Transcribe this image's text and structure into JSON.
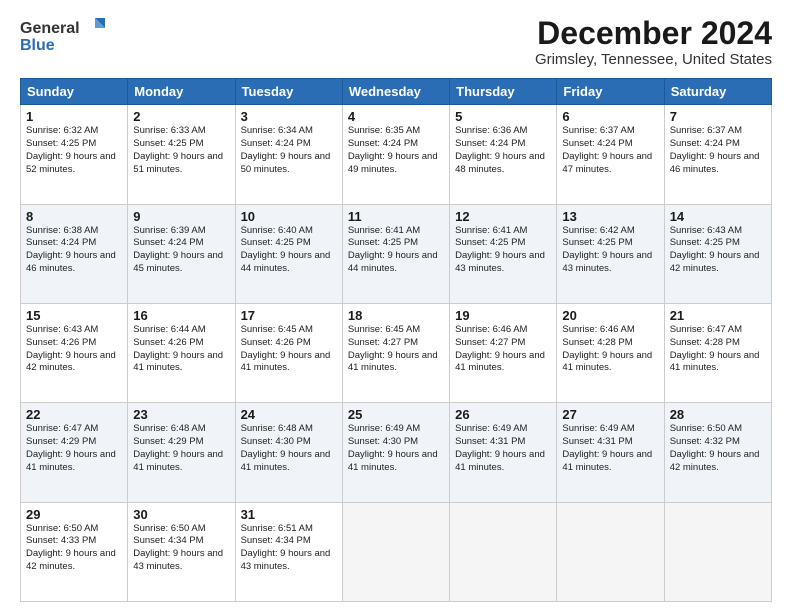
{
  "header": {
    "logo_general": "General",
    "logo_blue": "Blue",
    "title": "December 2024",
    "subtitle": "Grimsley, Tennessee, United States"
  },
  "days_of_week": [
    "Sunday",
    "Monday",
    "Tuesday",
    "Wednesday",
    "Thursday",
    "Friday",
    "Saturday"
  ],
  "weeks": [
    [
      {
        "day": "1",
        "sunrise": "6:32 AM",
        "sunset": "4:25 PM",
        "daylight": "9 hours and 52 minutes."
      },
      {
        "day": "2",
        "sunrise": "6:33 AM",
        "sunset": "4:25 PM",
        "daylight": "9 hours and 51 minutes."
      },
      {
        "day": "3",
        "sunrise": "6:34 AM",
        "sunset": "4:24 PM",
        "daylight": "9 hours and 50 minutes."
      },
      {
        "day": "4",
        "sunrise": "6:35 AM",
        "sunset": "4:24 PM",
        "daylight": "9 hours and 49 minutes."
      },
      {
        "day": "5",
        "sunrise": "6:36 AM",
        "sunset": "4:24 PM",
        "daylight": "9 hours and 48 minutes."
      },
      {
        "day": "6",
        "sunrise": "6:37 AM",
        "sunset": "4:24 PM",
        "daylight": "9 hours and 47 minutes."
      },
      {
        "day": "7",
        "sunrise": "6:37 AM",
        "sunset": "4:24 PM",
        "daylight": "9 hours and 46 minutes."
      }
    ],
    [
      {
        "day": "8",
        "sunrise": "6:38 AM",
        "sunset": "4:24 PM",
        "daylight": "9 hours and 46 minutes."
      },
      {
        "day": "9",
        "sunrise": "6:39 AM",
        "sunset": "4:24 PM",
        "daylight": "9 hours and 45 minutes."
      },
      {
        "day": "10",
        "sunrise": "6:40 AM",
        "sunset": "4:25 PM",
        "daylight": "9 hours and 44 minutes."
      },
      {
        "day": "11",
        "sunrise": "6:41 AM",
        "sunset": "4:25 PM",
        "daylight": "9 hours and 44 minutes."
      },
      {
        "day": "12",
        "sunrise": "6:41 AM",
        "sunset": "4:25 PM",
        "daylight": "9 hours and 43 minutes."
      },
      {
        "day": "13",
        "sunrise": "6:42 AM",
        "sunset": "4:25 PM",
        "daylight": "9 hours and 43 minutes."
      },
      {
        "day": "14",
        "sunrise": "6:43 AM",
        "sunset": "4:25 PM",
        "daylight": "9 hours and 42 minutes."
      }
    ],
    [
      {
        "day": "15",
        "sunrise": "6:43 AM",
        "sunset": "4:26 PM",
        "daylight": "9 hours and 42 minutes."
      },
      {
        "day": "16",
        "sunrise": "6:44 AM",
        "sunset": "4:26 PM",
        "daylight": "9 hours and 41 minutes."
      },
      {
        "day": "17",
        "sunrise": "6:45 AM",
        "sunset": "4:26 PM",
        "daylight": "9 hours and 41 minutes."
      },
      {
        "day": "18",
        "sunrise": "6:45 AM",
        "sunset": "4:27 PM",
        "daylight": "9 hours and 41 minutes."
      },
      {
        "day": "19",
        "sunrise": "6:46 AM",
        "sunset": "4:27 PM",
        "daylight": "9 hours and 41 minutes."
      },
      {
        "day": "20",
        "sunrise": "6:46 AM",
        "sunset": "4:28 PM",
        "daylight": "9 hours and 41 minutes."
      },
      {
        "day": "21",
        "sunrise": "6:47 AM",
        "sunset": "4:28 PM",
        "daylight": "9 hours and 41 minutes."
      }
    ],
    [
      {
        "day": "22",
        "sunrise": "6:47 AM",
        "sunset": "4:29 PM",
        "daylight": "9 hours and 41 minutes."
      },
      {
        "day": "23",
        "sunrise": "6:48 AM",
        "sunset": "4:29 PM",
        "daylight": "9 hours and 41 minutes."
      },
      {
        "day": "24",
        "sunrise": "6:48 AM",
        "sunset": "4:30 PM",
        "daylight": "9 hours and 41 minutes."
      },
      {
        "day": "25",
        "sunrise": "6:49 AM",
        "sunset": "4:30 PM",
        "daylight": "9 hours and 41 minutes."
      },
      {
        "day": "26",
        "sunrise": "6:49 AM",
        "sunset": "4:31 PM",
        "daylight": "9 hours and 41 minutes."
      },
      {
        "day": "27",
        "sunrise": "6:49 AM",
        "sunset": "4:31 PM",
        "daylight": "9 hours and 41 minutes."
      },
      {
        "day": "28",
        "sunrise": "6:50 AM",
        "sunset": "4:32 PM",
        "daylight": "9 hours and 42 minutes."
      }
    ],
    [
      {
        "day": "29",
        "sunrise": "6:50 AM",
        "sunset": "4:33 PM",
        "daylight": "9 hours and 42 minutes."
      },
      {
        "day": "30",
        "sunrise": "6:50 AM",
        "sunset": "4:34 PM",
        "daylight": "9 hours and 43 minutes."
      },
      {
        "day": "31",
        "sunrise": "6:51 AM",
        "sunset": "4:34 PM",
        "daylight": "9 hours and 43 minutes."
      },
      null,
      null,
      null,
      null
    ]
  ]
}
